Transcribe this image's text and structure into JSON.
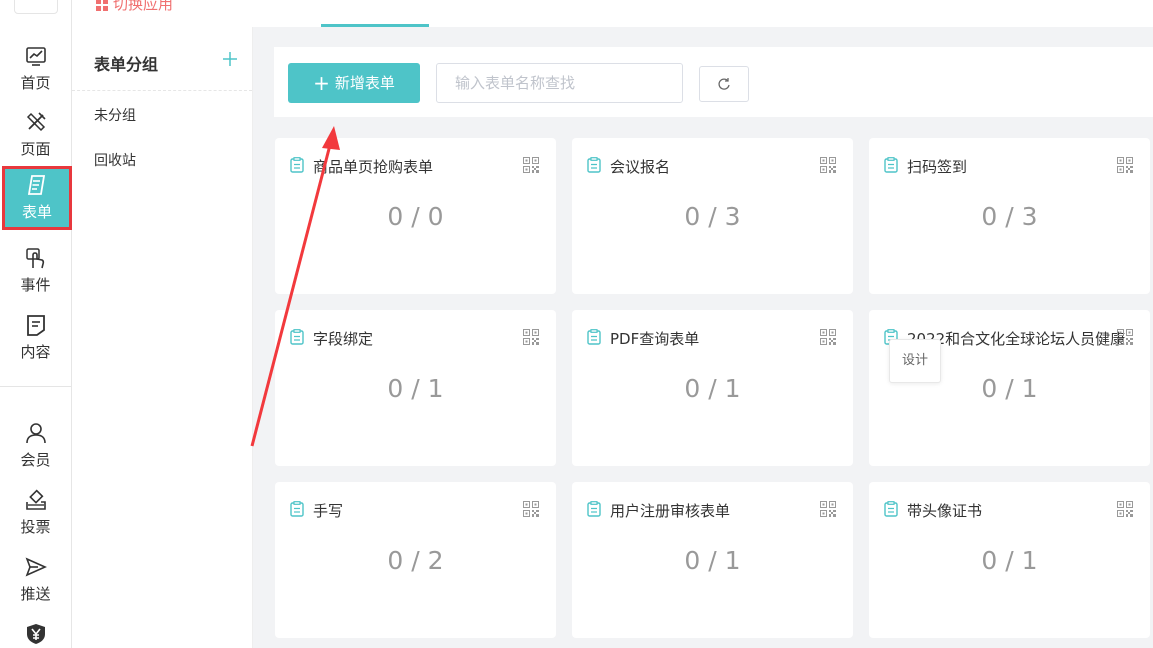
{
  "topbar": {
    "switch_app_label": "切换应用"
  },
  "nav": {
    "items": [
      {
        "label": "首页",
        "icon": "chart-icon"
      },
      {
        "label": "页面",
        "icon": "pen-ruler-icon"
      },
      {
        "label": "表单",
        "icon": "form-icon"
      },
      {
        "label": "事件",
        "icon": "touch-icon"
      },
      {
        "label": "内容",
        "icon": "document-icon"
      },
      {
        "label": "会员",
        "icon": "user-icon"
      },
      {
        "label": "投票",
        "icon": "vote-icon"
      },
      {
        "label": "推送",
        "icon": "send-icon"
      },
      {
        "label": "",
        "icon": "yen-shield-icon"
      }
    ],
    "active_index": 2
  },
  "groups": {
    "title": "表单分组",
    "add_icon": "plus-icon",
    "items": [
      "未分组",
      "回收站"
    ]
  },
  "toolbar": {
    "add_button": "新增表单",
    "search_placeholder": "输入表单名称查找",
    "refresh_icon": "refresh-icon"
  },
  "cards": [
    {
      "title": "商品单页抢购表单",
      "count": "0 / 0"
    },
    {
      "title": "会议报名",
      "count": "0 / 3"
    },
    {
      "title": "扫码签到",
      "count": "0 / 3"
    },
    {
      "title": "字段绑定",
      "count": "0 / 1"
    },
    {
      "title": "PDF查询表单",
      "count": "0 / 1"
    },
    {
      "title": "2022和合文化全球论坛人员健康",
      "count": "0 / 1"
    },
    {
      "title": "手写",
      "count": "0 / 2"
    },
    {
      "title": "用户注册审核表单",
      "count": "0 / 1"
    },
    {
      "title": "带头像证书",
      "count": "0 / 1"
    }
  ],
  "popover": {
    "design": "设计"
  },
  "colors": {
    "accent": "#4ec4c8",
    "highlight": "#e8383d",
    "switch_app": "#f07070"
  }
}
